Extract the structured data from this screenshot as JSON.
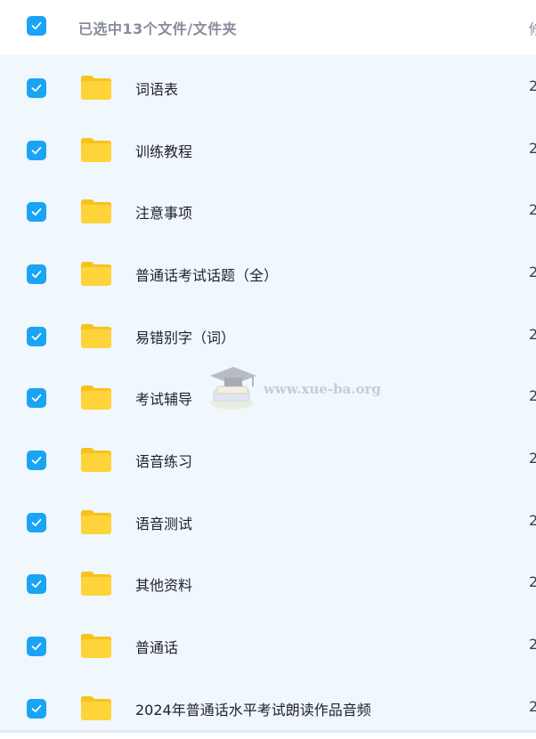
{
  "header": {
    "selected_text": "已选中13个文件/文件夹",
    "column_hint": "修"
  },
  "rows": [
    {
      "name": "词语表",
      "date_hint": "2"
    },
    {
      "name": "训练教程",
      "date_hint": "2"
    },
    {
      "name": "注意事项",
      "date_hint": "2"
    },
    {
      "name": "普通话考试话题（全）",
      "date_hint": "2"
    },
    {
      "name": "易错别字（词）",
      "date_hint": "2"
    },
    {
      "name": "考试辅导",
      "date_hint": "2"
    },
    {
      "name": "语音练习",
      "date_hint": "2"
    },
    {
      "name": "语音测试",
      "date_hint": "2"
    },
    {
      "name": "其他资料",
      "date_hint": "2"
    },
    {
      "name": "普通话",
      "date_hint": "2"
    },
    {
      "name": "2024年普通话水平考试朗读作品音频",
      "date_hint": "2"
    }
  ],
  "watermark": {
    "text": "www.xue-ba.org"
  },
  "colors": {
    "checkbox": "#1aa4f5",
    "row_background": "#f0f7fd",
    "folder": "#ffd33a",
    "folder_back": "#f7c21b"
  },
  "icons": {
    "checkbox": "check-icon",
    "folder": "folder-icon"
  }
}
